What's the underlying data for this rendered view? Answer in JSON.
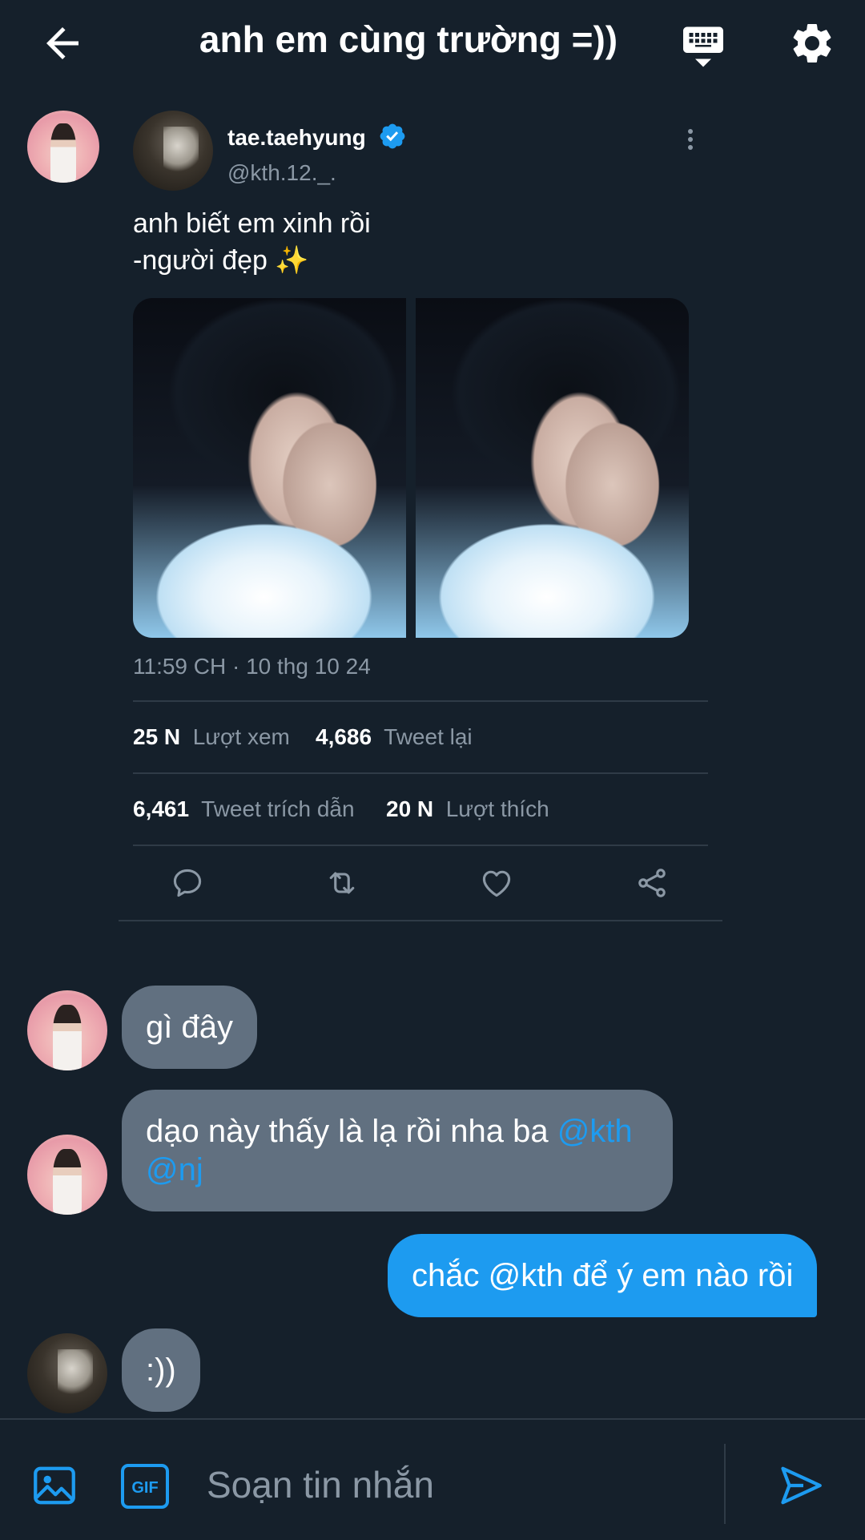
{
  "header": {
    "title": "anh em cùng trường =))"
  },
  "shared_tweet": {
    "name": "tae.taehyung",
    "handle": "@kth.12._.",
    "text_line1": "anh biết em xinh rồi",
    "text_line2": "-người đẹp ✨",
    "timestamp": "11:59 CH · 10 thg 10 24",
    "stats": {
      "views_value": "25 N",
      "views_label": "Lượt xem",
      "retweets_value": "4,686",
      "retweets_label": "Tweet lại",
      "quotes_value": "6,461",
      "quotes_label": "Tweet trích dẫn",
      "likes_value": "20 N",
      "likes_label": "Lượt thích"
    }
  },
  "messages": [
    {
      "text": "gì đây"
    },
    {
      "text": "dạo này thấy là lạ rồi nha ba ",
      "mention1": "@kth",
      "mention2": "@nj"
    },
    {
      "text": "chắc @kth để ý em nào rồi"
    },
    {
      "text": ":))"
    }
  ],
  "composer": {
    "placeholder": "Soạn tin nhắn",
    "gif_label": "GIF"
  },
  "colors": {
    "background": "#15202b",
    "accent": "#1d9bf0",
    "bubble_other": "#617080",
    "muted_text": "#8b98a5"
  }
}
